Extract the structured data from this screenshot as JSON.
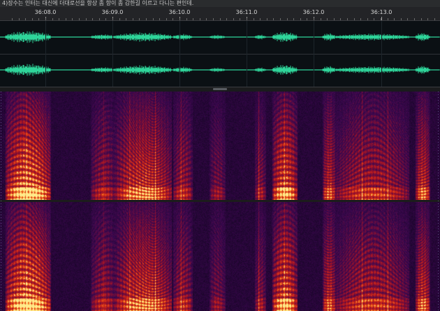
{
  "caption": {
    "text": "4)장수는 인터는 대신에 더대로선을 항상 좀 항이 좀 감한길 이르고 다니는 편인데."
  },
  "ruler": {
    "labels": [
      "36:08.0",
      "36:09.0",
      "36:10.0",
      "36:11.0",
      "36:12.0",
      "36:13.0"
    ]
  },
  "colors": {
    "waveform": "#2fd59a",
    "spectral_low": "#1a0630",
    "spectral_mid": "#c2151a",
    "spectral_high": "#ffe07a"
  },
  "view": {
    "channels": 2,
    "display": "waveform + spectral frequency"
  }
}
